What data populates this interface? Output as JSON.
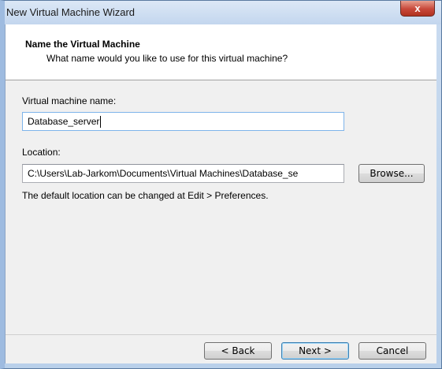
{
  "window": {
    "title": "New Virtual Machine Wizard",
    "close_label": "x"
  },
  "header": {
    "title": "Name the Virtual Machine",
    "subtitle": "What name would you like to use for this virtual machine?"
  },
  "form": {
    "vm_name_label": "Virtual machine name:",
    "vm_name_value": "Database_server",
    "location_label": "Location:",
    "location_value": "C:\\Users\\Lab-Jarkom\\Documents\\Virtual Machines\\Database_se",
    "browse_label": "Browse...",
    "hint": "The default location can be changed at Edit > Preferences."
  },
  "footer": {
    "back_label": "< Back",
    "next_label": "Next >",
    "cancel_label": "Cancel"
  }
}
